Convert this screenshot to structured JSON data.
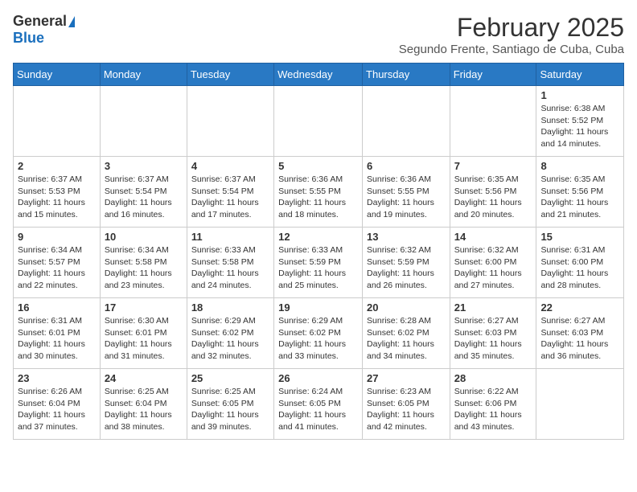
{
  "header": {
    "logo_general": "General",
    "logo_blue": "Blue",
    "month": "February 2025",
    "location": "Segundo Frente, Santiago de Cuba, Cuba"
  },
  "weekdays": [
    "Sunday",
    "Monday",
    "Tuesday",
    "Wednesday",
    "Thursday",
    "Friday",
    "Saturday"
  ],
  "weeks": [
    [
      {
        "day": "",
        "sunrise": "",
        "sunset": "",
        "daylight": ""
      },
      {
        "day": "",
        "sunrise": "",
        "sunset": "",
        "daylight": ""
      },
      {
        "day": "",
        "sunrise": "",
        "sunset": "",
        "daylight": ""
      },
      {
        "day": "",
        "sunrise": "",
        "sunset": "",
        "daylight": ""
      },
      {
        "day": "",
        "sunrise": "",
        "sunset": "",
        "daylight": ""
      },
      {
        "day": "",
        "sunrise": "",
        "sunset": "",
        "daylight": ""
      },
      {
        "day": "1",
        "sunrise": "6:38 AM",
        "sunset": "5:52 PM",
        "daylight": "11 hours and 14 minutes."
      }
    ],
    [
      {
        "day": "2",
        "sunrise": "6:37 AM",
        "sunset": "5:53 PM",
        "daylight": "11 hours and 15 minutes."
      },
      {
        "day": "3",
        "sunrise": "6:37 AM",
        "sunset": "5:54 PM",
        "daylight": "11 hours and 16 minutes."
      },
      {
        "day": "4",
        "sunrise": "6:37 AM",
        "sunset": "5:54 PM",
        "daylight": "11 hours and 17 minutes."
      },
      {
        "day": "5",
        "sunrise": "6:36 AM",
        "sunset": "5:55 PM",
        "daylight": "11 hours and 18 minutes."
      },
      {
        "day": "6",
        "sunrise": "6:36 AM",
        "sunset": "5:55 PM",
        "daylight": "11 hours and 19 minutes."
      },
      {
        "day": "7",
        "sunrise": "6:35 AM",
        "sunset": "5:56 PM",
        "daylight": "11 hours and 20 minutes."
      },
      {
        "day": "8",
        "sunrise": "6:35 AM",
        "sunset": "5:56 PM",
        "daylight": "11 hours and 21 minutes."
      }
    ],
    [
      {
        "day": "9",
        "sunrise": "6:34 AM",
        "sunset": "5:57 PM",
        "daylight": "11 hours and 22 minutes."
      },
      {
        "day": "10",
        "sunrise": "6:34 AM",
        "sunset": "5:58 PM",
        "daylight": "11 hours and 23 minutes."
      },
      {
        "day": "11",
        "sunrise": "6:33 AM",
        "sunset": "5:58 PM",
        "daylight": "11 hours and 24 minutes."
      },
      {
        "day": "12",
        "sunrise": "6:33 AM",
        "sunset": "5:59 PM",
        "daylight": "11 hours and 25 minutes."
      },
      {
        "day": "13",
        "sunrise": "6:32 AM",
        "sunset": "5:59 PM",
        "daylight": "11 hours and 26 minutes."
      },
      {
        "day": "14",
        "sunrise": "6:32 AM",
        "sunset": "6:00 PM",
        "daylight": "11 hours and 27 minutes."
      },
      {
        "day": "15",
        "sunrise": "6:31 AM",
        "sunset": "6:00 PM",
        "daylight": "11 hours and 28 minutes."
      }
    ],
    [
      {
        "day": "16",
        "sunrise": "6:31 AM",
        "sunset": "6:01 PM",
        "daylight": "11 hours and 30 minutes."
      },
      {
        "day": "17",
        "sunrise": "6:30 AM",
        "sunset": "6:01 PM",
        "daylight": "11 hours and 31 minutes."
      },
      {
        "day": "18",
        "sunrise": "6:29 AM",
        "sunset": "6:02 PM",
        "daylight": "11 hours and 32 minutes."
      },
      {
        "day": "19",
        "sunrise": "6:29 AM",
        "sunset": "6:02 PM",
        "daylight": "11 hours and 33 minutes."
      },
      {
        "day": "20",
        "sunrise": "6:28 AM",
        "sunset": "6:02 PM",
        "daylight": "11 hours and 34 minutes."
      },
      {
        "day": "21",
        "sunrise": "6:27 AM",
        "sunset": "6:03 PM",
        "daylight": "11 hours and 35 minutes."
      },
      {
        "day": "22",
        "sunrise": "6:27 AM",
        "sunset": "6:03 PM",
        "daylight": "11 hours and 36 minutes."
      }
    ],
    [
      {
        "day": "23",
        "sunrise": "6:26 AM",
        "sunset": "6:04 PM",
        "daylight": "11 hours and 37 minutes."
      },
      {
        "day": "24",
        "sunrise": "6:25 AM",
        "sunset": "6:04 PM",
        "daylight": "11 hours and 38 minutes."
      },
      {
        "day": "25",
        "sunrise": "6:25 AM",
        "sunset": "6:05 PM",
        "daylight": "11 hours and 39 minutes."
      },
      {
        "day": "26",
        "sunrise": "6:24 AM",
        "sunset": "6:05 PM",
        "daylight": "11 hours and 41 minutes."
      },
      {
        "day": "27",
        "sunrise": "6:23 AM",
        "sunset": "6:05 PM",
        "daylight": "11 hours and 42 minutes."
      },
      {
        "day": "28",
        "sunrise": "6:22 AM",
        "sunset": "6:06 PM",
        "daylight": "11 hours and 43 minutes."
      },
      {
        "day": "",
        "sunrise": "",
        "sunset": "",
        "daylight": ""
      }
    ]
  ]
}
